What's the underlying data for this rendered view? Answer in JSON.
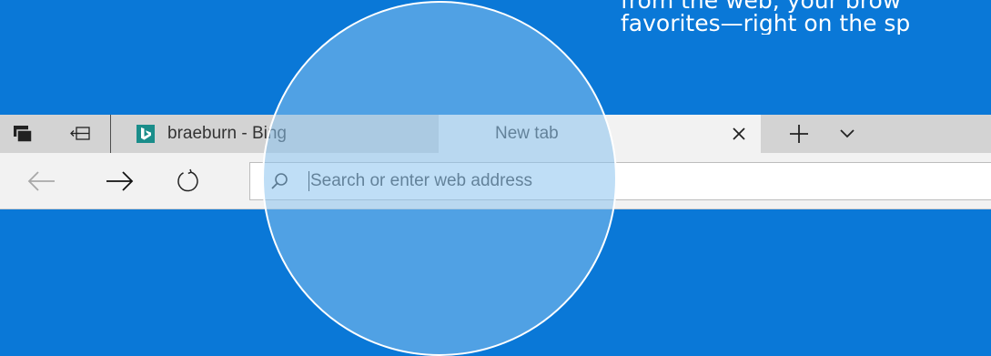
{
  "intro": {
    "line1": "from the web, your brow",
    "line2": "favorites—right on the sp"
  },
  "tabbar": {
    "tabs": [
      {
        "label": "braeburn - Bing",
        "favicon": "bing-logo-icon"
      },
      {
        "label": "New tab"
      }
    ],
    "icons": {
      "tabs_aside": "tabs-aside-icon",
      "set_aside": "set-aside-icon",
      "close": "close-icon",
      "new_tab": "plus-icon",
      "tab_list": "chevron-down-icon"
    }
  },
  "navbar": {
    "address_placeholder": "Search or enter web address",
    "icons": {
      "back": "back-arrow-icon",
      "forward": "forward-arrow-icon",
      "refresh": "refresh-icon",
      "search": "search-icon"
    }
  },
  "colors": {
    "background": "#0a78d7",
    "tabbar": "#d3d3d3",
    "active_tab": "#f2f2f2",
    "bing_teal": "#1a8d8a"
  }
}
